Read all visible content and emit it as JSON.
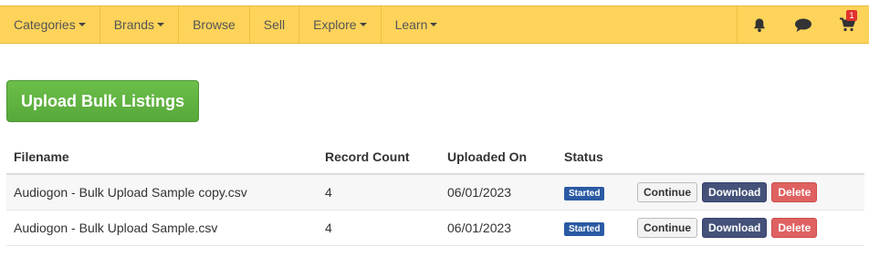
{
  "nav": {
    "items": [
      {
        "label": "Categories",
        "dropdown": true
      },
      {
        "label": "Brands",
        "dropdown": true
      },
      {
        "label": "Browse",
        "dropdown": false
      },
      {
        "label": "Sell",
        "dropdown": false
      },
      {
        "label": "Explore",
        "dropdown": true
      },
      {
        "label": "Learn",
        "dropdown": true
      }
    ],
    "icons": [
      "bell-icon",
      "chat-icon",
      "cart-icon"
    ],
    "cart_count": "1",
    "bar_color": "#fdd35a"
  },
  "upload_button": {
    "label": "Upload Bulk Listings",
    "color": "#5cb03e"
  },
  "table": {
    "headers": {
      "filename": "Filename",
      "record_count": "Record Count",
      "uploaded_on": "Uploaded On",
      "status": "Status"
    },
    "rows": [
      {
        "filename": "Audiogon - Bulk Upload Sample copy.csv",
        "record_count": "4",
        "uploaded_on": "06/01/2023",
        "status": "Started",
        "actions": {
          "continue": "Continue",
          "download": "Download",
          "delete": "Delete"
        }
      },
      {
        "filename": "Audiogon - Bulk Upload Sample.csv",
        "record_count": "4",
        "uploaded_on": "06/01/2023",
        "status": "Started",
        "actions": {
          "continue": "Continue",
          "download": "Download",
          "delete": "Delete"
        }
      }
    ]
  }
}
